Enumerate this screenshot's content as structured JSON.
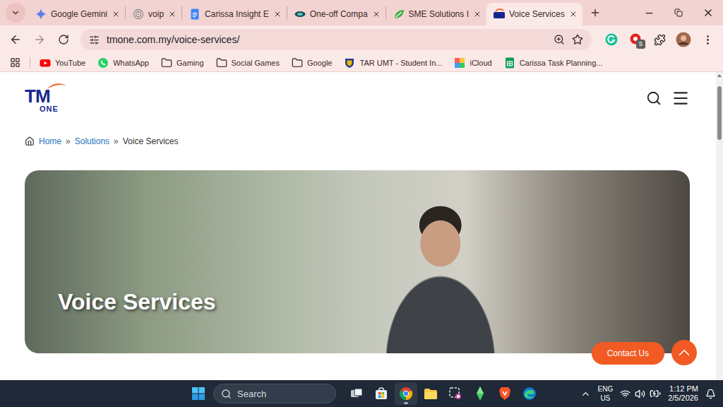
{
  "browser": {
    "tabs": [
      {
        "label": "Google Gemini",
        "kind": "gemini",
        "selected": false
      },
      {
        "label": "voip",
        "kind": "voip",
        "selected": false
      },
      {
        "label": "Carissa Insight E",
        "kind": "docs",
        "selected": false
      },
      {
        "label": "One-off Compa",
        "kind": "ctos",
        "selected": false
      },
      {
        "label": "SME Solutions I",
        "kind": "sme",
        "selected": false
      },
      {
        "label": "Voice Services",
        "kind": "tm",
        "selected": true
      }
    ],
    "url": "tmone.com.my/voice-services/",
    "extension_badge": "5",
    "bookmarks": [
      {
        "label": "YouTube",
        "kind": "youtube"
      },
      {
        "label": "WhatsApp",
        "kind": "whatsapp"
      },
      {
        "label": "Gaming",
        "kind": "folder"
      },
      {
        "label": "Social Games",
        "kind": "folder"
      },
      {
        "label": "Google",
        "kind": "folder"
      },
      {
        "label": "TAR UMT - Student In...",
        "kind": "tarumt"
      },
      {
        "label": "iCloud",
        "kind": "icloud"
      },
      {
        "label": "Carissa Task Planning...",
        "kind": "sheets"
      }
    ]
  },
  "page": {
    "logo": {
      "top": "TM",
      "bottom": "ONE"
    },
    "breadcrumb": [
      {
        "label": "Home",
        "link": true
      },
      {
        "label": "Solutions",
        "link": true
      },
      {
        "label": "Voice Services",
        "link": false
      }
    ],
    "breadcrumb_separator": "»",
    "hero_title": "Voice Services",
    "contact_button": "Contact Us"
  },
  "taskbar": {
    "search_placeholder": "Search",
    "apps": [
      {
        "kind": "taskview",
        "active": false
      },
      {
        "kind": "store",
        "active": false
      },
      {
        "kind": "chrome",
        "active": true
      },
      {
        "kind": "explorer",
        "active": false
      },
      {
        "kind": "snip",
        "active": false
      },
      {
        "kind": "sims",
        "active": false
      },
      {
        "kind": "brave",
        "active": false
      },
      {
        "kind": "edge",
        "active": false
      }
    ],
    "language": {
      "top": "ENG",
      "bottom": "US"
    },
    "time": "1:12 PM",
    "date": "2/5/2026"
  }
}
